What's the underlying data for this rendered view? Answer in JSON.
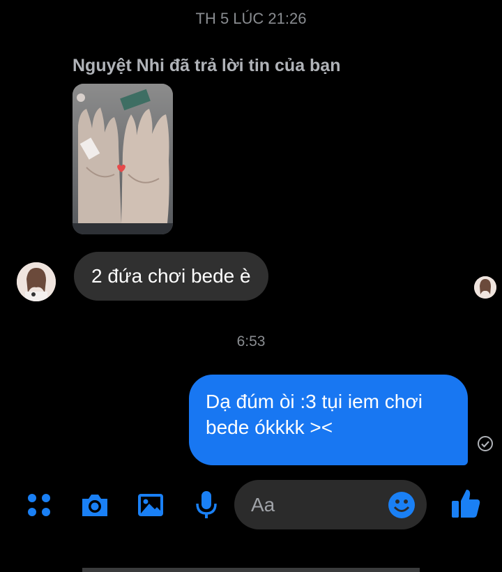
{
  "thread": {
    "timestamp_1": "TH 5 LÚC 21:26",
    "timestamp_2": "6:53"
  },
  "reply": {
    "label": "Nguyệt Nhi đã trả lời tin của bạn"
  },
  "messages": {
    "incoming_text": "2 đứa chơi bede è",
    "outgoing_line_1": "Dạ đúm òi :3 tụi iem chơi",
    "outgoing_line_2": "bede ókkkk ><"
  },
  "composer": {
    "placeholder": "Aa"
  },
  "icons": {
    "menu": "four-dots-icon",
    "camera": "camera-icon",
    "gallery": "image-icon",
    "mic": "microphone-icon",
    "emoji": "smiley-icon",
    "like": "thumbs-up-icon",
    "seen": "check-circle-icon"
  },
  "colors": {
    "accent": "#1877f2",
    "incoming_bubble": "#303030",
    "background": "#000000",
    "muted_text": "#8a8d91"
  }
}
